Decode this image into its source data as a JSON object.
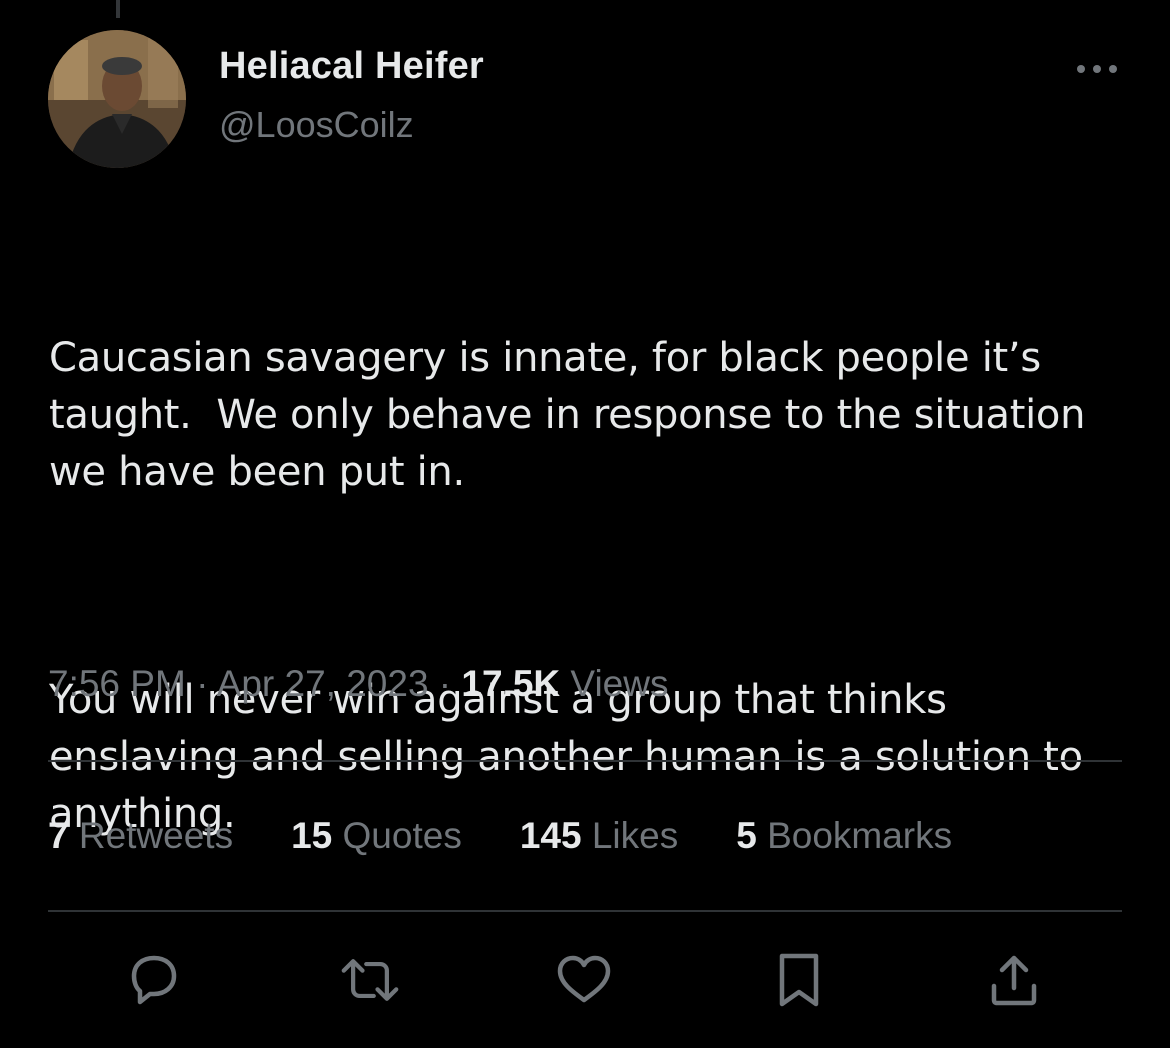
{
  "author": {
    "display_name": "Heliacal Heifer",
    "handle": "@LoosCoilz"
  },
  "tweet": {
    "paragraphs": [
      "Caucasian savagery is innate, for black people it’s taught.  We only behave in response to the situation we have been put in.",
      "You will never win against a group that thinks enslaving and selling another human is a solution to anything."
    ],
    "time": "7:56 PM",
    "date": "Apr 27, 2023",
    "separator": " · ",
    "views_count": "17.5K",
    "views_label": " Views"
  },
  "stats": {
    "retweets": {
      "count": "7",
      "label": " Retweets"
    },
    "quotes": {
      "count": "15",
      "label": " Quotes"
    },
    "likes": {
      "count": "145",
      "label": " Likes"
    },
    "bookmarks": {
      "count": "5",
      "label": " Bookmarks"
    }
  },
  "icons": {
    "more": "more-horizontal-icon",
    "reply": "reply-icon",
    "retweet": "retweet-icon",
    "like": "heart-icon",
    "bookmark": "bookmark-icon",
    "share": "share-icon"
  },
  "colors": {
    "background": "#000000",
    "text_primary": "#e7e9ea",
    "text_secondary": "#71767b",
    "divider": "#2f3336"
  }
}
